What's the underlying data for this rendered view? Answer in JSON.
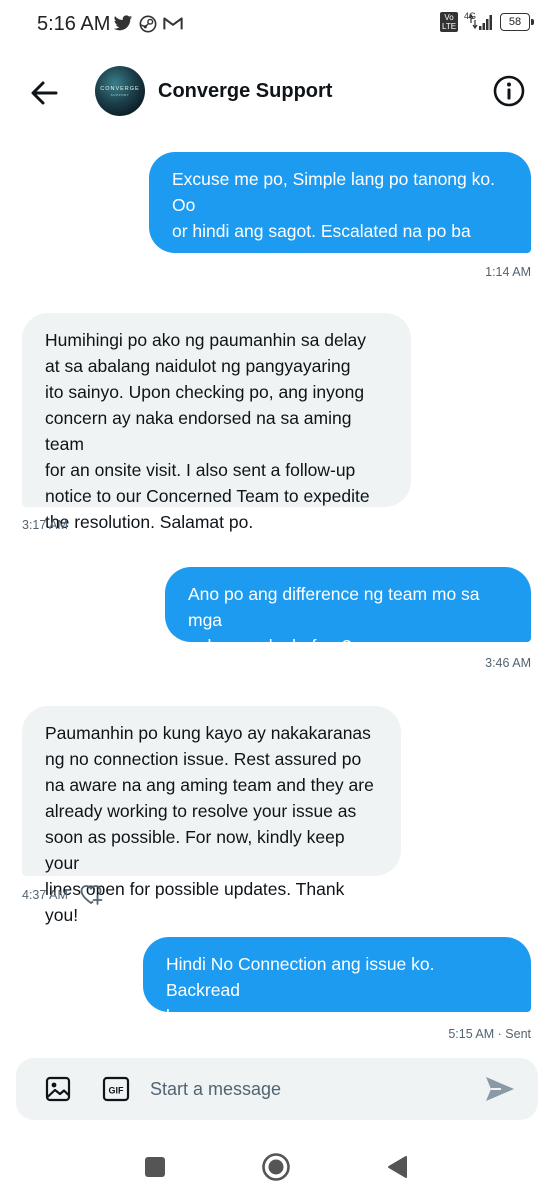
{
  "status_bar": {
    "time": "5:16 AM",
    "notification_icons": [
      "twitter-icon",
      "steam-icon",
      "gmail-icon"
    ],
    "volte": "Vo LTE",
    "network": "4G",
    "battery": "58"
  },
  "header": {
    "avatar_brand": "CONVERGE",
    "avatar_sub": "SUPPORT",
    "contact_name": "Converge Support"
  },
  "messages": [
    {
      "direction": "out",
      "text": "Excuse me po, Simple lang po tanong ko. Oo\nor hindi ang sagot. Escalated na po ba yung\ncase ko",
      "time": "1:14 AM"
    },
    {
      "direction": "in",
      "text": "Humihingi po ako ng paumanhin sa delay\nat sa abalang naidulot ng pangyayaring\nito sainyo. Upon checking po, ang inyong\nconcern ay naka endorsed na sa aming team\nfor an onsite visit. I also sent a follow-up\nnotice to our Concerned Team to expedite\nthe resolution. Salamat po.",
      "time": "3:17 AM"
    },
    {
      "direction": "out",
      "text": "Ano po ang difference ng team mo sa mga\nnakausap ko before?",
      "time": "3:46 AM"
    },
    {
      "direction": "in",
      "text": "Paumanhin po kung kayo ay nakakaranas\nng no connection issue. Rest assured po\nna aware na ang aming team and they are\nalready working to resolve your issue as\nsoon as possible. For now, kindly keep your\nlines open for possible updates. Thank you!",
      "time": "4:37 AM"
    },
    {
      "direction": "out",
      "text": "Hindi No Connection ang issue ko. Backread\nkayo",
      "time": "5:15 AM · Sent"
    }
  ],
  "composer": {
    "placeholder": "Start a message",
    "gif_label": "GIF"
  },
  "colors": {
    "accent": "#1d9bf0",
    "incoming_bubble": "#eff3f4",
    "text": "#0f1419",
    "muted": "#536471"
  }
}
